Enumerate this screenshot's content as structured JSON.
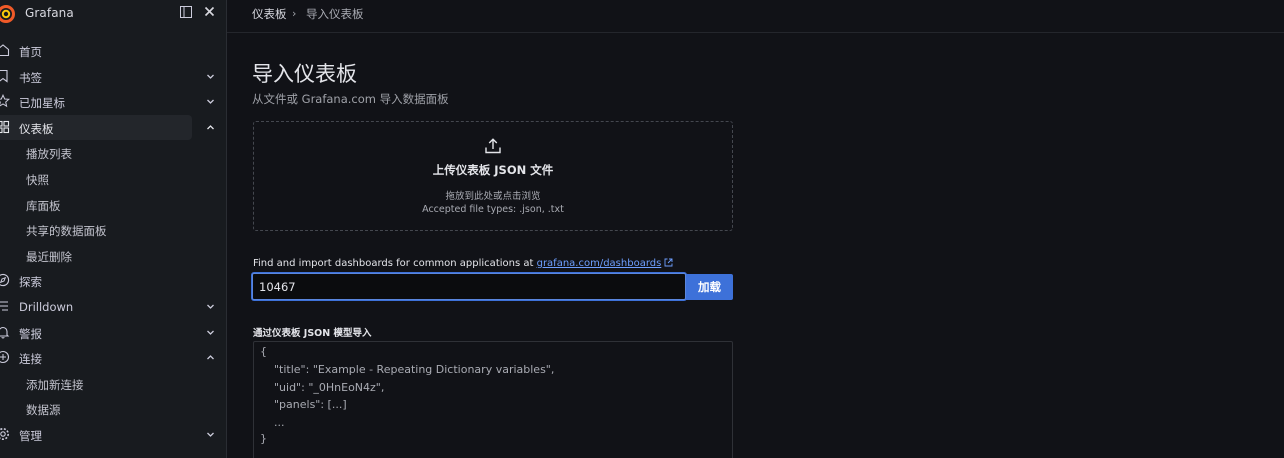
{
  "brand": {
    "name": "Grafana",
    "accent_colors": [
      "#f05a28",
      "#fbca0a"
    ]
  },
  "sidebar": {
    "dock_icon": "dock-panel-icon",
    "close_icon": "close-icon",
    "items": [
      {
        "label": "首页",
        "icon": "home-icon"
      },
      {
        "label": "书签",
        "icon": "bookmark-icon",
        "expandable": true
      },
      {
        "label": "已加星标",
        "icon": "star-icon",
        "expandable": true
      },
      {
        "label": "仪表板",
        "icon": "dashboards-icon",
        "expanded": true,
        "active": true
      },
      {
        "label": "播放列表",
        "child": true
      },
      {
        "label": "快照",
        "child": true
      },
      {
        "label": "库面板",
        "child": true
      },
      {
        "label": "共享的数据面板",
        "child": true
      },
      {
        "label": "最近删除",
        "child": true
      },
      {
        "label": "探索",
        "icon": "compass-icon"
      },
      {
        "label": "Drilldown",
        "icon": "drilldown-icon",
        "expandable": true
      },
      {
        "label": "警报",
        "icon": "bell-icon",
        "expandable": true
      },
      {
        "label": "连接",
        "icon": "connections-icon",
        "expanded": true
      },
      {
        "label": "添加新连接",
        "child": true
      },
      {
        "label": "数据源",
        "child": true
      },
      {
        "label": "管理",
        "icon": "cog-icon",
        "expandable": true
      }
    ]
  },
  "breadcrumb": {
    "items": [
      "仪表板",
      "导入仪表板"
    ],
    "separator": "›"
  },
  "page": {
    "title": "导入仪表板",
    "subtitle": "从文件或 Grafana.com 导入数据面板"
  },
  "upload": {
    "icon": "upload-icon",
    "title": "上传仪表板 JSON 文件",
    "hint": "拖放到此处或点击浏览",
    "accepted": "Accepted file types: .json, .txt"
  },
  "grafana_com": {
    "text": "Find and import dashboards for common applications at ",
    "link": "grafana.com/dashboards",
    "input_value": "10467",
    "load_label": "加载",
    "accent": "#3d71d9"
  },
  "json_model": {
    "label": "通过仪表板 JSON 模型导入",
    "lines": [
      "{",
      "    \"title\": \"Example - Repeating Dictionary variables\",",
      "    \"uid\": \"_0HnEoN4z\",",
      "    \"panels\": [...]",
      "    ...",
      "}"
    ]
  }
}
